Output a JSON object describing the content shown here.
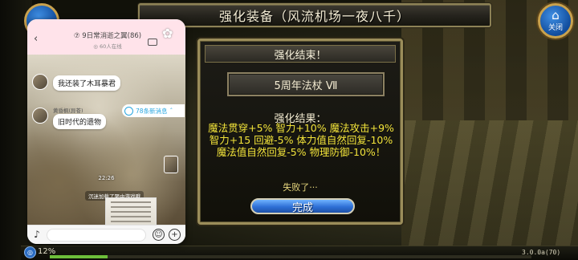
{
  "game": {
    "title": "强化装备（风流机场一夜八千）",
    "close_button": {
      "label": "关闭"
    },
    "dialog": {
      "header": "强化结束！",
      "item_name": "5周年法杖 Ⅶ",
      "result_label": "强化结果：",
      "result_text": "魔法贯穿+5% 智力+10% 魔法攻击+9% 智力+15 回避-5% 体力值自然回复-10% 魔法值自然回复-5% 物理防御-10%！",
      "fail_text": "失败了···",
      "done_button": "完成"
    },
    "exp": {
      "percent_label": "12%",
      "fill_fraction": 0.12,
      "icon": "exp-orb-icon"
    },
    "version": "3.0.0a(70)"
  },
  "chat": {
    "title": "⑦ 9日常消逝之翼(86)",
    "subtitle": "◎ 60人在线",
    "new_messages": "78条新消息",
    "messages": [
      {
        "text": "我还装了木耳暴君"
      },
      {
        "sender": "黄昏枫(异苍)",
        "text": "旧时代的遗物"
      }
    ],
    "timestamp": "22:26",
    "notice": "沉迷加载了聚中游戏哦"
  },
  "colors": {
    "accent_gold": "#9b8d5a",
    "result_yellow": "#f2e33a",
    "done_button_blue": "#2e6fd6",
    "chat_header_pink": "#ffe3ea"
  }
}
